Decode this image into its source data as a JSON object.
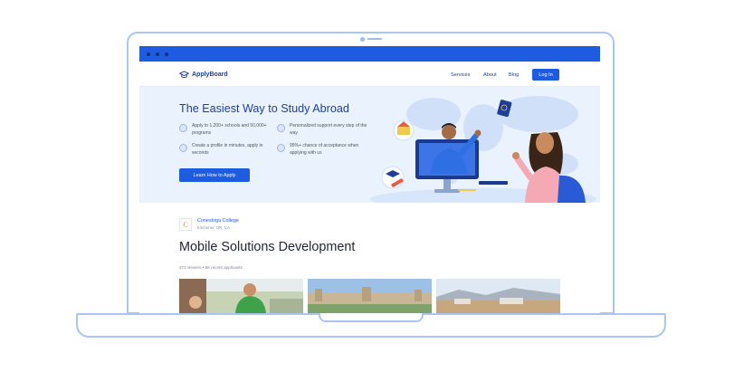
{
  "nav": {
    "brand": "ApplyBoard",
    "links": [
      "Services",
      "About",
      "Blog"
    ],
    "login_label": "Log In"
  },
  "hero": {
    "title": "The Easiest Way to Study Abroad",
    "features": [
      {
        "icon": "school-icon",
        "text": "Apply to 1,200+ schools and 50,000+ programs"
      },
      {
        "icon": "support-icon",
        "text": "Personalized support every step of the way"
      },
      {
        "icon": "profile-icon",
        "text": "Create a profile in minutes, apply in seconds"
      },
      {
        "icon": "check-icon",
        "text": "95%+ chance of acceptance when applying with us"
      }
    ],
    "cta_label": "Learn How to Apply"
  },
  "program": {
    "college_logo_letter": "C",
    "college_name": "Conestoga College",
    "college_location": "Kitchener, ON, CA",
    "title": "Mobile Solutions Development",
    "stats": "372 viewers • 86 recent applicants"
  },
  "colors": {
    "brand_blue": "#1d5be0",
    "navy": "#1d3f9b",
    "hero_bg": "#eaf3fd",
    "frame": "#a9c6f1"
  }
}
